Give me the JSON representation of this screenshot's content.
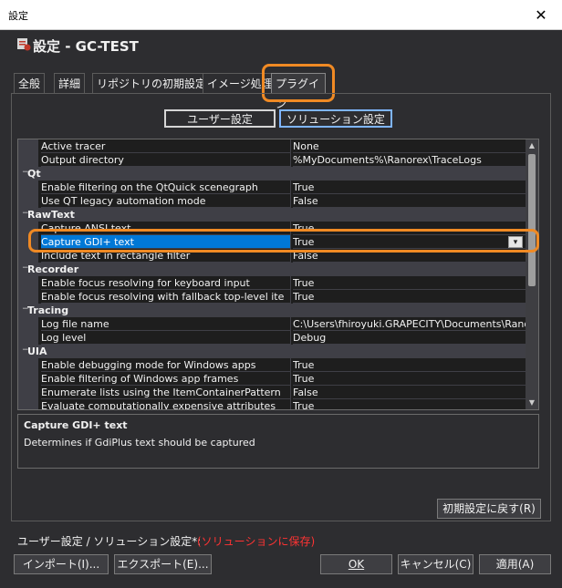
{
  "window": {
    "title": "設定",
    "close_glyph": "✕"
  },
  "header": {
    "title": "設定 - GC-TEST"
  },
  "tabs": [
    {
      "label": "全般"
    },
    {
      "label": "詳細"
    },
    {
      "label": "リポジトリの初期設定"
    },
    {
      "label": "イメージ処理"
    },
    {
      "label": "プラグイン",
      "active": true
    }
  ],
  "scope": {
    "user": "ユーザー設定",
    "solution": "ソリューション設定",
    "selected": "solution"
  },
  "grid": {
    "rows": [
      {
        "type": "prop",
        "name": "Active tracer",
        "value": "None"
      },
      {
        "type": "prop",
        "name": "Output directory",
        "value": "%MyDocuments%\\Ranorex\\TraceLogs"
      },
      {
        "type": "cat",
        "name": "Qt",
        "toggle": "−"
      },
      {
        "type": "prop",
        "name": "Enable filtering on the QtQuick scenegraph",
        "value": "True"
      },
      {
        "type": "prop",
        "name": "Use QT legacy automation mode",
        "value": "False"
      },
      {
        "type": "cat",
        "name": "RawText",
        "toggle": "−"
      },
      {
        "type": "prop",
        "name": "Capture ANSI text",
        "value": "True"
      },
      {
        "type": "prop",
        "name": "Capture GDI+ text",
        "value": "True",
        "selected": true
      },
      {
        "type": "prop",
        "name": "Include text in rectangle filter",
        "value": "False"
      },
      {
        "type": "cat",
        "name": "Recorder",
        "toggle": "−"
      },
      {
        "type": "prop",
        "name": "Enable focus resolving for keyboard input",
        "value": "True"
      },
      {
        "type": "prop",
        "name": "Enable focus resolving with fallback top-level ite",
        "value": "True"
      },
      {
        "type": "cat",
        "name": "Tracing",
        "toggle": "−"
      },
      {
        "type": "prop",
        "name": "Log file name",
        "value": "C:\\Users\\fhiroyuki.GRAPECITY\\Documents\\Ranorex\\"
      },
      {
        "type": "prop",
        "name": "Log level",
        "value": "Debug"
      },
      {
        "type": "cat",
        "name": "UIA",
        "toggle": "−"
      },
      {
        "type": "prop",
        "name": "Enable debugging mode for Windows apps",
        "value": "True"
      },
      {
        "type": "prop",
        "name": "Enable filtering of Windows app frames",
        "value": "True"
      },
      {
        "type": "prop",
        "name": "Enumerate lists using the ItemContainerPattern",
        "value": "False"
      },
      {
        "type": "prop",
        "name": "Evaluate computationally expensive attributes",
        "value": "True"
      }
    ],
    "dropdown_glyph": "▾",
    "scroll_up": "▲",
    "scroll_down": "▼"
  },
  "description": {
    "title": "Capture GDI+ text",
    "text": "Determines if GdiPlus text should be captured"
  },
  "buttons": {
    "reset": "初期設定に戻す(R)",
    "import": "インポート(I)...",
    "export": "エクスポート(E)...",
    "ok": "OK",
    "cancel": "キャンセル(C)",
    "apply": "適用(A)"
  },
  "note": {
    "label": "ユーザー設定 / ソリューション設定*:",
    "value": "(ソリューションに保存)"
  },
  "colors": {
    "accent": "#0078d7",
    "highlight": "#f08a24",
    "warning": "#ff3333",
    "background": "#2d2d30"
  }
}
